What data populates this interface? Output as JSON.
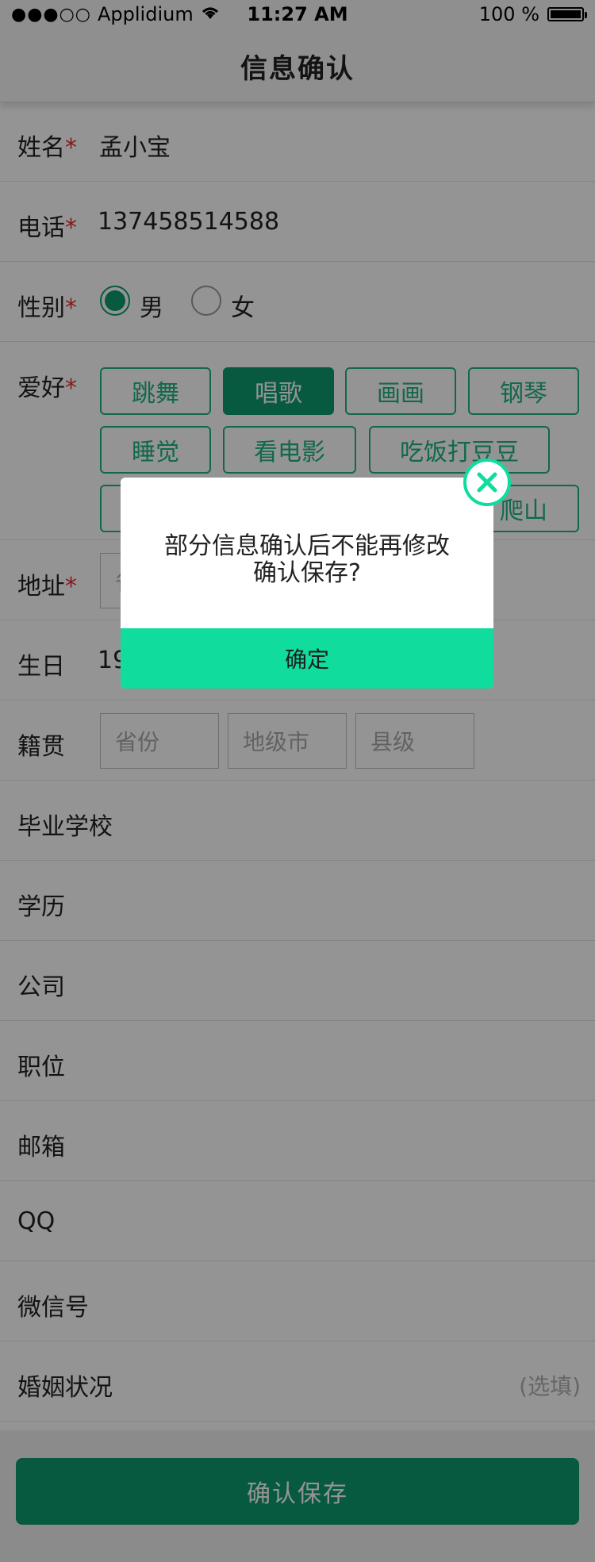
{
  "status_bar": {
    "signal_dots": "●●●○○",
    "carrier": "Applidium",
    "time": "11:27 AM",
    "battery_text": "100 %",
    "wifi_icon": "wifi-icon",
    "battery_icon": "battery-icon"
  },
  "nav": {
    "title": "信息确认"
  },
  "form": {
    "name": {
      "label": "姓名",
      "required": "*",
      "value": "孟小宝"
    },
    "phone": {
      "label": "电话",
      "required": "*",
      "value": "137458514588"
    },
    "gender": {
      "label": "性别",
      "required": "*",
      "options": [
        "男",
        "女"
      ],
      "selected": "男"
    },
    "hobbies": {
      "label": "爱好",
      "required": "*",
      "tags": [
        "跳舞",
        "唱歌",
        "画画",
        "钢琴",
        "睡觉",
        "看电影",
        "吃饭打豆豆",
        "爬山"
      ],
      "selected": [
        "唱歌"
      ]
    },
    "address": {
      "label": "地址",
      "required": "*",
      "placeholder": "省"
    },
    "birthday": {
      "label": "生日",
      "value": "19"
    },
    "hometown": {
      "label": "籍贯",
      "placeholders": [
        "省份",
        "地级市",
        "县级"
      ]
    },
    "school": {
      "label": "毕业学校"
    },
    "education": {
      "label": "学历"
    },
    "company": {
      "label": "公司"
    },
    "position": {
      "label": "职位"
    },
    "email": {
      "label": "邮箱"
    },
    "qq": {
      "label": "QQ"
    },
    "wechat": {
      "label": "微信号"
    },
    "marital": {
      "label": "婚姻状况",
      "hint": "(选填)"
    }
  },
  "footer": {
    "confirm_label": "确认保存"
  },
  "dialog": {
    "message_line1": "部分信息确认后不能再修改",
    "message_line2": "确认保存?",
    "ok_label": "确定",
    "close_icon": "close-icon"
  },
  "colors": {
    "primary": "#0d9c6e",
    "tag_border": "#20b384",
    "dialog_button": "#10dc9d",
    "required": "#e52d2d"
  }
}
